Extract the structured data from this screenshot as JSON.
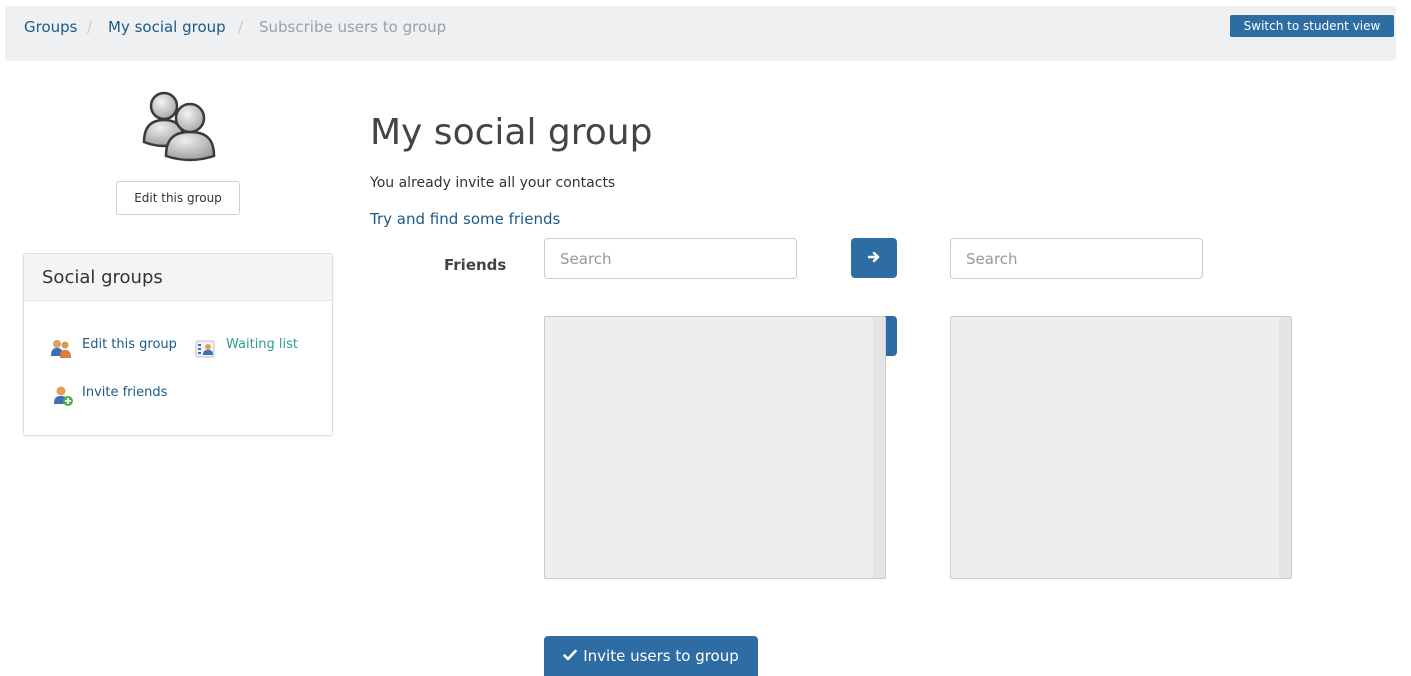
{
  "breadcrumb": {
    "items": [
      {
        "label": "Groups"
      },
      {
        "label": "My social group"
      },
      {
        "label": "Subscribe users to group"
      }
    ],
    "separator": "/"
  },
  "header": {
    "student_view_label": "Switch to student view"
  },
  "sidebar": {
    "edit_button_label": "Edit this group",
    "panel_title": "Social groups",
    "links": {
      "edit_group": "Edit this group",
      "waiting_list": "Waiting list",
      "invite_friends": "Invite friends"
    }
  },
  "main": {
    "title": "My social group",
    "message": "You already invite all your contacts",
    "find_friends_link": "Try and find some friends",
    "friends_label": "Friends",
    "left_search_placeholder": "Search",
    "right_search_placeholder": "Search",
    "submit_label": "Invite users to group"
  },
  "icons": {
    "move_right": "arrow-right-icon",
    "move_left": "arrow-left-icon",
    "submit": "check-icon",
    "avatar": "group-users-icon"
  },
  "colors": {
    "primary": "#2e6da4",
    "link": "#1c5a8a",
    "link_green": "#2a9d8f",
    "breadcrumb_bg": "#eef0f2"
  }
}
